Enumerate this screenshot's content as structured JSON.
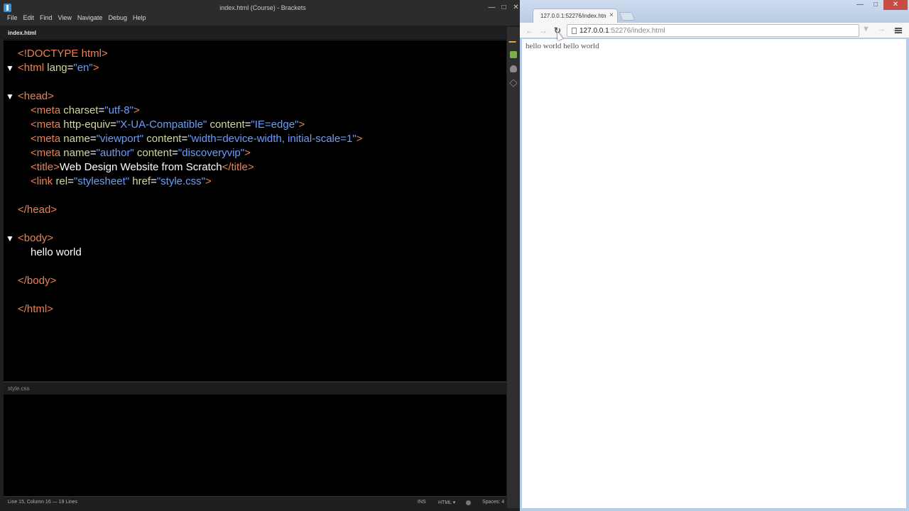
{
  "brackets": {
    "window_title": "index.html (Course) - Brackets",
    "window_controls": [
      "—",
      "□",
      "✕"
    ],
    "menu": [
      "File",
      "Edit",
      "Find",
      "View",
      "Navigate",
      "Debug",
      "Help"
    ],
    "active_file": "index.html",
    "code_lines": [
      {
        "fold": false,
        "indent": 0,
        "tokens": [
          {
            "c": "tg",
            "t": "<!DOCTYPE html>"
          }
        ]
      },
      {
        "fold": true,
        "indent": 0,
        "tokens": [
          {
            "c": "tg",
            "t": "<html "
          },
          {
            "c": "at",
            "t": "lang"
          },
          {
            "c": "tx",
            "t": "="
          },
          {
            "c": "vl",
            "t": "\"en\""
          },
          {
            "c": "tg",
            "t": ">"
          }
        ]
      },
      {
        "fold": false,
        "indent": 0,
        "tokens": []
      },
      {
        "fold": true,
        "indent": 0,
        "tokens": [
          {
            "c": "tg",
            "t": "<head>"
          }
        ]
      },
      {
        "fold": false,
        "indent": 1,
        "tokens": [
          {
            "c": "tg",
            "t": "<meta "
          },
          {
            "c": "at",
            "t": "charset"
          },
          {
            "c": "tx",
            "t": "="
          },
          {
            "c": "vl",
            "t": "\"utf-8\""
          },
          {
            "c": "tg",
            "t": ">"
          }
        ]
      },
      {
        "fold": false,
        "indent": 1,
        "tokens": [
          {
            "c": "tg",
            "t": "<meta "
          },
          {
            "c": "at",
            "t": "http-equiv"
          },
          {
            "c": "tx",
            "t": "="
          },
          {
            "c": "vl",
            "t": "\"X-UA-Compatible\""
          },
          {
            "c": "at",
            "t": " content"
          },
          {
            "c": "tx",
            "t": "="
          },
          {
            "c": "vl",
            "t": "\"IE=edge\""
          },
          {
            "c": "tg",
            "t": ">"
          }
        ]
      },
      {
        "fold": false,
        "indent": 1,
        "tokens": [
          {
            "c": "tg",
            "t": "<meta "
          },
          {
            "c": "at",
            "t": "name"
          },
          {
            "c": "tx",
            "t": "="
          },
          {
            "c": "vl",
            "t": "\"viewport\""
          },
          {
            "c": "at",
            "t": " content"
          },
          {
            "c": "tx",
            "t": "="
          },
          {
            "c": "vl",
            "t": "\"width=device-width, initial-scale=1\""
          },
          {
            "c": "tg",
            "t": ">"
          }
        ]
      },
      {
        "fold": false,
        "indent": 1,
        "tokens": [
          {
            "c": "tg",
            "t": "<meta "
          },
          {
            "c": "at",
            "t": "name"
          },
          {
            "c": "tx",
            "t": "="
          },
          {
            "c": "vl",
            "t": "\"author\""
          },
          {
            "c": "at",
            "t": " content"
          },
          {
            "c": "tx",
            "t": "="
          },
          {
            "c": "vl",
            "t": "\"discoveryvip\""
          },
          {
            "c": "tg",
            "t": ">"
          }
        ]
      },
      {
        "fold": false,
        "indent": 1,
        "tokens": [
          {
            "c": "tg",
            "t": "<title>"
          },
          {
            "c": "tx",
            "t": "Web Design Website from Scratch"
          },
          {
            "c": "tg",
            "t": "</title>"
          }
        ]
      },
      {
        "fold": false,
        "indent": 1,
        "tokens": [
          {
            "c": "tg",
            "t": "<link "
          },
          {
            "c": "at",
            "t": "rel"
          },
          {
            "c": "tx",
            "t": "="
          },
          {
            "c": "vl",
            "t": "\"stylesheet\""
          },
          {
            "c": "at",
            "t": " href"
          },
          {
            "c": "tx",
            "t": "="
          },
          {
            "c": "vl",
            "t": "\"style.css\""
          },
          {
            "c": "tg",
            "t": ">"
          }
        ]
      },
      {
        "fold": false,
        "indent": 0,
        "tokens": []
      },
      {
        "fold": false,
        "indent": 0,
        "tokens": [
          {
            "c": "tg",
            "t": "</head>"
          }
        ]
      },
      {
        "fold": false,
        "indent": 0,
        "tokens": []
      },
      {
        "fold": true,
        "indent": 0,
        "tokens": [
          {
            "c": "tg",
            "t": "<body>"
          }
        ]
      },
      {
        "fold": false,
        "indent": 1,
        "tokens": [
          {
            "c": "tx",
            "t": "hello world"
          }
        ]
      },
      {
        "fold": false,
        "indent": 0,
        "tokens": []
      },
      {
        "fold": false,
        "indent": 0,
        "tokens": [
          {
            "c": "tg",
            "t": "</body>"
          }
        ]
      },
      {
        "fold": false,
        "indent": 0,
        "tokens": []
      },
      {
        "fold": false,
        "indent": 0,
        "tokens": [
          {
            "c": "tg",
            "t": "</html>"
          }
        ]
      }
    ],
    "second_pane_file": "style.css",
    "status": {
      "cursor": "Line 15, Column 16 — 19 Lines",
      "mode": "INS",
      "language": "HTML ▾",
      "spaces": "Spaces: 4"
    },
    "colors": {
      "tag": "#e88354",
      "attribute": "#d5d69e",
      "value": "#6c9ef8",
      "text": "#ffffff"
    }
  },
  "chrome": {
    "tab_title": "127.0.0.1:52276/index.html",
    "tab_close": "×",
    "window_controls": [
      "—",
      "□",
      "✕"
    ],
    "nav": {
      "back": "←",
      "forward": "→",
      "reload": "↻"
    },
    "url_host": "127.0.0.1",
    "url_rest": ":52276/index.html",
    "star": "☆",
    "ext1": "▼",
    "ext2": "→",
    "page_text": "hello world hello world"
  }
}
